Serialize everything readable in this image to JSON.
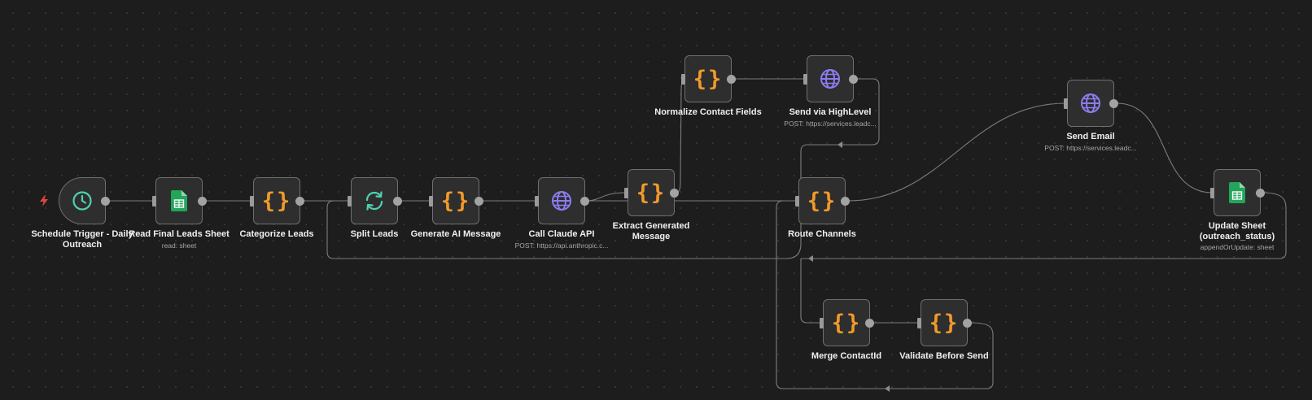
{
  "nodes": {
    "schedule_trigger": {
      "label": "Schedule Trigger - Daily\nOutreach",
      "icon": "clock-icon"
    },
    "read_sheet": {
      "label": "Read Final Leads Sheet",
      "sub": "read: sheet",
      "icon": "google-sheets-icon"
    },
    "categorize": {
      "label": "Categorize Leads",
      "icon": "code-icon"
    },
    "split": {
      "label": "Split Leads",
      "icon": "loop-icon"
    },
    "generate": {
      "label": "Generate AI Message",
      "icon": "code-icon"
    },
    "call_claude": {
      "label": "Call Claude API",
      "sub": "POST: https://api.anthropic.c...",
      "icon": "globe-icon"
    },
    "extract": {
      "label": "Extract Generated\nMessage",
      "icon": "code-icon"
    },
    "normalize": {
      "label": "Normalize Contact Fields",
      "icon": "code-icon"
    },
    "send_highlevel": {
      "label": "Send via HighLevel",
      "sub": "POST: https://services.leadc...",
      "icon": "globe-icon"
    },
    "route": {
      "label": "Route Channels",
      "icon": "code-icon"
    },
    "send_email": {
      "label": "Send Email",
      "sub": "POST: https://services.leadc...",
      "icon": "globe-icon"
    },
    "update_sheet": {
      "label": "Update Sheet\n(outreach_status)",
      "sub": "appendOrUpdate: sheet",
      "icon": "google-sheets-icon"
    },
    "merge": {
      "label": "Merge ContactId",
      "icon": "code-icon"
    },
    "validate": {
      "label": "Validate Before Send",
      "icon": "code-icon"
    }
  },
  "glyphs": {
    "code": "{}"
  },
  "colors": {
    "code_icon": "#f19a2b",
    "globe_icon": "#8b7cf0",
    "loop_icon": "#4fd1b0",
    "clock_icon": "#4fd1b0",
    "sheets_icon": "#23a55a",
    "trigger_bolt": "#e2453c"
  }
}
